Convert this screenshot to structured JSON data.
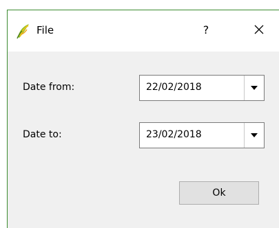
{
  "window": {
    "title": "File",
    "help_label": "?",
    "app_icon": "qgis-logo-icon",
    "close_icon": "close-icon",
    "border_color": "#3a8a2e"
  },
  "form": {
    "date_from_label": "Date from:",
    "date_from_value": "22/02/2018",
    "date_to_label": "Date to:",
    "date_to_value": "23/02/2018",
    "dropdown_icon": "chevron-down-icon"
  },
  "actions": {
    "ok_label": "Ok"
  }
}
